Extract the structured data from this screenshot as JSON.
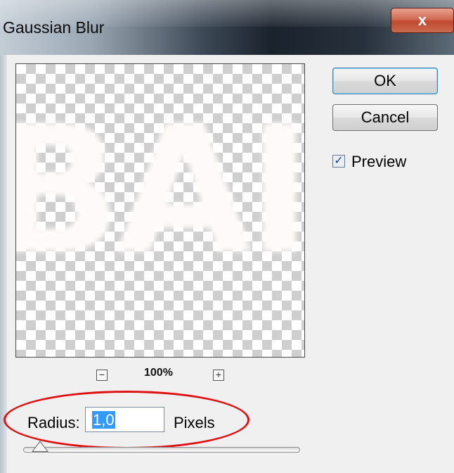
{
  "window": {
    "title": "Gaussian Blur",
    "close_glyph": "x"
  },
  "preview": {
    "blurred_text": "BAI",
    "zoom_out_glyph": "−",
    "zoom_in_glyph": "+",
    "zoom_level": "100%"
  },
  "buttons": {
    "ok_label": "OK",
    "cancel_label": "Cancel"
  },
  "preview_option": {
    "label": "Preview",
    "checked": true,
    "check_glyph": "✓"
  },
  "radius": {
    "label": "Radius:",
    "value": "1,0",
    "unit": "Pixels"
  },
  "slider": {
    "value_fraction": 0.04
  },
  "colors": {
    "annotation_ellipse": "#e01010",
    "selection": "#3399ff",
    "ok_border": "#3c7fb1",
    "close_button": "#c04a2f"
  }
}
